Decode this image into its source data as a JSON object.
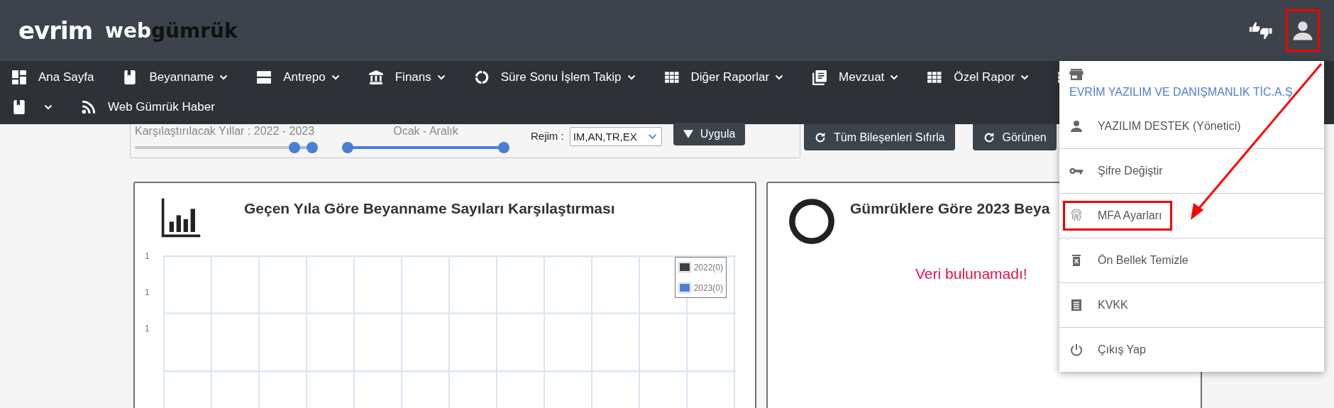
{
  "header": {
    "logo": "evrim",
    "product_prefix": "web",
    "product_name": "gümrük",
    "account_button": {
      "highlighted": true
    }
  },
  "nav": {
    "rows": [
      [
        {
          "label": "Ana Sayfa",
          "kind": "dashboard",
          "dropdown": false
        },
        {
          "label": "Beyanname",
          "kind": "book",
          "dropdown": true
        },
        {
          "label": "Antrepo",
          "kind": "storage",
          "dropdown": true
        },
        {
          "label": "Finans",
          "kind": "bank",
          "dropdown": true
        },
        {
          "label": "Süre Sonu İşlem Takip",
          "kind": "ring",
          "dropdown": true
        },
        {
          "label": "Diğer Raporlar",
          "kind": "grid",
          "dropdown": true
        },
        {
          "label": "Mevzuat",
          "kind": "doc",
          "dropdown": true
        },
        {
          "label": "Özel Rapor",
          "kind": "grid",
          "dropdown": true
        },
        {
          "kind": "grid",
          "dropdown": false
        }
      ],
      [
        {
          "kind": "book",
          "dropdown": true
        },
        {
          "label": "Web Gümrük Haber",
          "kind": "rss",
          "dropdown": false
        }
      ]
    ]
  },
  "filters": {
    "years": {
      "label": "Karşılaştırılacak Yıllar : 2022 - 2023",
      "thumbs": [
        {
          "level": 0.9
        },
        {
          "level": 1
        }
      ]
    },
    "months": {
      "label": "Ocak - Aralık",
      "thumbs": [
        {
          "level": 0
        },
        {
          "level": 1
        }
      ]
    },
    "regime": {
      "label": "Rejim :",
      "value": "IM,AN,TR,EX"
    },
    "apply": "Uygula"
  },
  "actions": [
    "Tüm Bileşenleri Sıfırla",
    "Görünen"
  ],
  "cards": [
    {
      "kind": "bar",
      "title": "Geçen Yıla Göre Beyanname Sayıları Karşılaştırması",
      "y_labels": [
        "1",
        "1",
        "1"
      ],
      "legend": [
        {
          "label": "2022(0)",
          "color": "#3a4149"
        },
        {
          "label": "2023(0)",
          "color": "#4a7fd4"
        }
      ]
    },
    {
      "kind": "donut",
      "title": "Gümrüklere Göre 2023 Beya",
      "message": "Veri bulunamadı!"
    }
  ],
  "user_menu": {
    "company": "EVRİM YAZILIM VE DANIŞMANLIK TİC.A.Ş.",
    "items": [
      {
        "label": "YAZILIM DESTEK (Yönetici)",
        "kind": "person",
        "highlighted": false
      },
      {
        "label": "Şifre Değiştir",
        "kind": "key",
        "highlighted": false
      },
      {
        "label": "MFA Ayarları",
        "kind": "fingerprint",
        "highlighted": true
      },
      {
        "label": "Ön Bellek Temizle",
        "kind": "trash",
        "highlighted": false
      },
      {
        "label": "KVKK",
        "kind": "receipt",
        "highlighted": false
      },
      {
        "label": "Çıkış Yap",
        "kind": "power",
        "highlighted": false
      }
    ]
  }
}
